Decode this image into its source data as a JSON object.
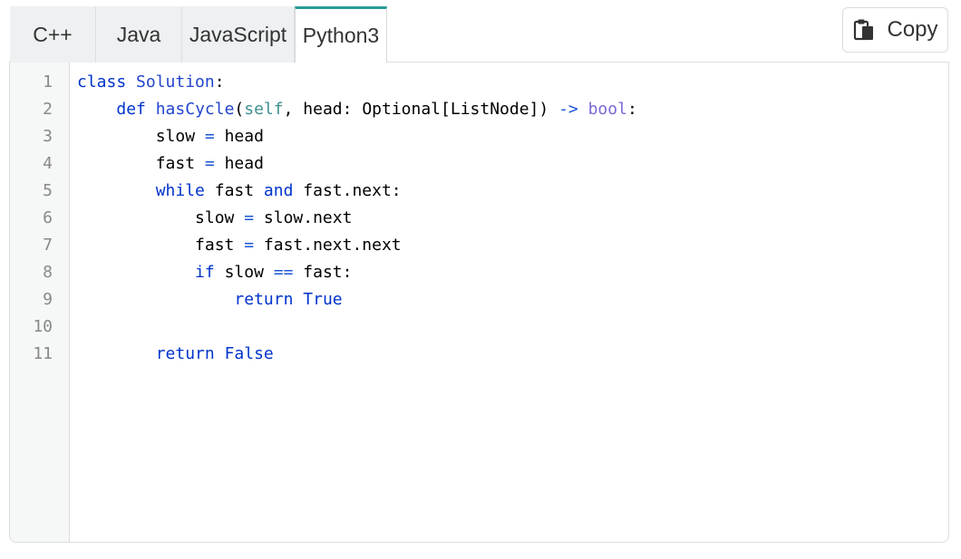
{
  "tabs": [
    {
      "label": "C++",
      "active": false
    },
    {
      "label": "Java",
      "active": false
    },
    {
      "label": "JavaScript",
      "active": false
    },
    {
      "label": "Python3",
      "active": true
    }
  ],
  "copy_button": {
    "label": "Copy",
    "icon": "clipboard-icon"
  },
  "editor": {
    "line_numbers": [
      "1",
      "2",
      "3",
      "4",
      "5",
      "6",
      "7",
      "8",
      "9",
      "10",
      "11"
    ],
    "lines": [
      "class Solution:",
      "    def hasCycle(self, head: Optional[ListNode]) -> bool:",
      "        slow = head",
      "        fast = head",
      "        while fast and fast.next:",
      "            slow = slow.next",
      "            fast = fast.next.next",
      "            if slow == fast:",
      "                return True",
      "",
      "        return False"
    ]
  },
  "colors": {
    "keyword": "#0033cc",
    "self": "#3f8f8f",
    "builtin_type": "#7a68d8",
    "active_tab_accent": "#2a9c96",
    "tab_background": "#eef0f1"
  }
}
